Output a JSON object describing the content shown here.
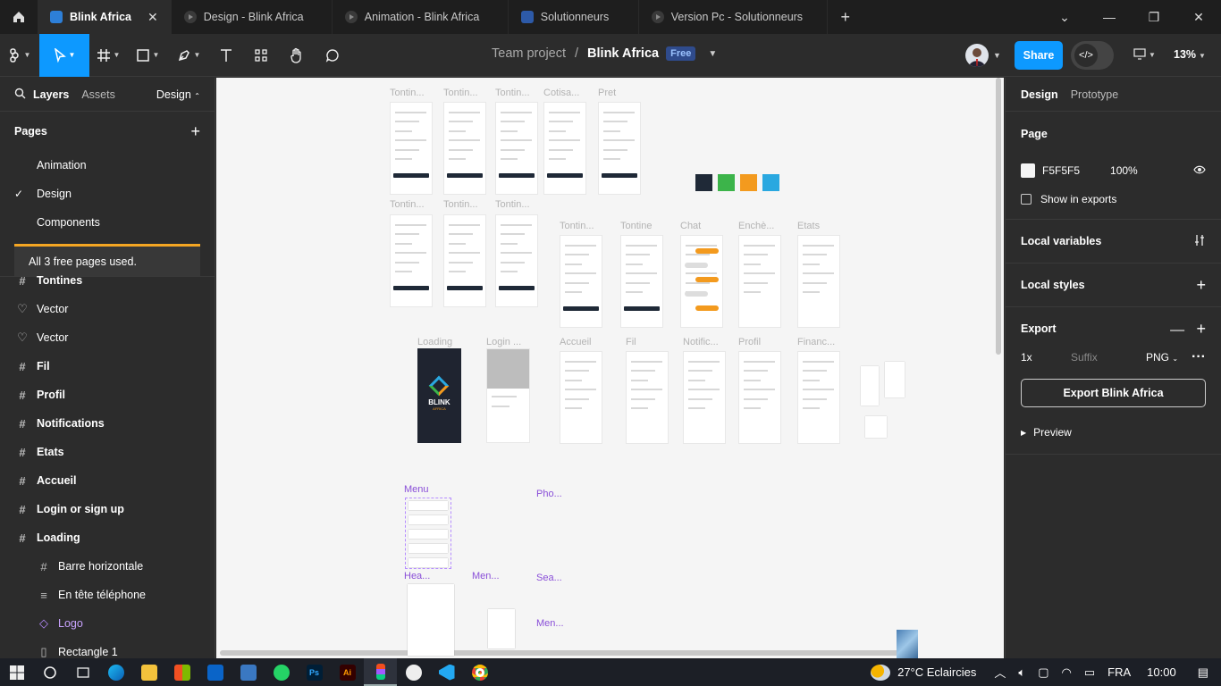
{
  "tabs": [
    {
      "label": "Blink Africa",
      "active": true
    },
    {
      "label": "Design - Blink Africa",
      "active": false
    },
    {
      "label": "Animation - Blink Africa",
      "active": false
    },
    {
      "label": "Solutionneurs",
      "active": false
    },
    {
      "label": "Version Pc - Solutionneurs",
      "active": false
    }
  ],
  "breadcrumb": {
    "team": "Team project",
    "separator": "/",
    "file": "Blink Africa",
    "badge": "Free"
  },
  "toolbar": {
    "share_label": "Share",
    "zoom": "13%"
  },
  "left_panel": {
    "tab_layers": "Layers",
    "tab_assets": "Assets",
    "tab_design": "Design",
    "pages_title": "Pages",
    "pages": [
      {
        "label": "Animation",
        "selected": false
      },
      {
        "label": "Design",
        "selected": true
      },
      {
        "label": "Components",
        "selected": false
      }
    ],
    "free_notice": "All 3 free pages used.",
    "layers": [
      {
        "label": "Tontines",
        "icon": "frame-icon",
        "bold": true
      },
      {
        "label": "Vector",
        "icon": "vector-icon",
        "bold": false
      },
      {
        "label": "Vector",
        "icon": "vector-icon",
        "bold": false
      },
      {
        "label": "Fil",
        "icon": "frame-icon",
        "bold": true
      },
      {
        "label": "Profil",
        "icon": "frame-icon",
        "bold": true
      },
      {
        "label": "Notifications",
        "icon": "frame-icon",
        "bold": true
      },
      {
        "label": "Etats",
        "icon": "frame-icon",
        "bold": true
      },
      {
        "label": "Accueil",
        "icon": "frame-icon",
        "bold": true
      },
      {
        "label": "Login or sign up",
        "icon": "frame-icon",
        "bold": true
      },
      {
        "label": "Loading",
        "icon": "frame-icon",
        "bold": true
      },
      {
        "label": "Barre horizontale",
        "icon": "frame-icon",
        "bold": false,
        "sub": true
      },
      {
        "label": "En tête téléphone",
        "icon": "autolayout-icon",
        "bold": false,
        "sub": true
      },
      {
        "label": "Logo",
        "icon": "instance-icon",
        "bold": false,
        "sub": true,
        "purple": true
      },
      {
        "label": "Rectangle 1",
        "icon": "rectangle-icon",
        "bold": false,
        "sub": true
      }
    ]
  },
  "canvas": {
    "frames_row1": [
      "Tontin...",
      "Tontin...",
      "Tontin...",
      "Cotisa...",
      "Pret"
    ],
    "frames_row2": [
      "Tontin...",
      "Tontin...",
      "Tontin..."
    ],
    "frames_row2b": [
      "Tontin...",
      "Tontine",
      "Chat",
      "Enchè...",
      "Etats"
    ],
    "frames_row3": [
      "Loading",
      "Login ...",
      "Accueil",
      "Fil",
      "Notific...",
      "Profil",
      "Financ..."
    ],
    "components": [
      "Menu",
      "Pho...",
      "Hea...",
      "Men...",
      "Sea...",
      "Men..."
    ],
    "palette": [
      "#1f2937",
      "#3cb44a",
      "#f39a1e",
      "#2aa8e0"
    ],
    "loading_brand": "BLINK",
    "loading_sub": "AFRICA"
  },
  "right_panel": {
    "tab_design": "Design",
    "tab_prototype": "Prototype",
    "page_title": "Page",
    "page_color": "F5F5F5",
    "page_opacity": "100%",
    "show_in_exports": "Show in exports",
    "local_variables": "Local variables",
    "local_styles": "Local styles",
    "export_title": "Export",
    "export_scale": "1x",
    "export_suffix_placeholder": "Suffix",
    "export_format": "PNG",
    "export_button": "Export Blink Africa",
    "preview": "Preview"
  },
  "taskbar": {
    "weather": "27°C  Eclaircies",
    "lang": "FRA",
    "time": "10:00"
  }
}
